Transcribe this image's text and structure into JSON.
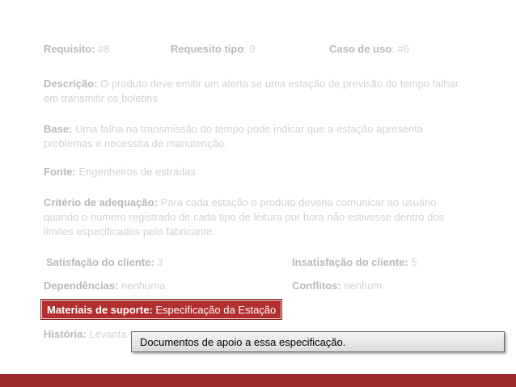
{
  "requisito": {
    "label": "Requisito:",
    "value": "#8"
  },
  "requisito_tipo": {
    "label": "Requesito tipo",
    "value": ": 9"
  },
  "caso_uso": {
    "label": "Caso de uso",
    "value": ": #6"
  },
  "descricao": {
    "label": "Descrição:",
    "value": "O produto deve emitir um alerta se uma estação de previsão do tempo falhar em transmitir  os boletins"
  },
  "base": {
    "label": "Base:",
    "value": "Uma falha na transmissão do tempo pode indicar que a estação apresenta problemas e necessita de manutenção."
  },
  "fonte": {
    "label": "Fonte:",
    "value": "Engenheiros de estradas"
  },
  "criterio": {
    "label": "Critério de adequação:",
    "value": "Para cada estação o produto deveria comunicar ao usuário quando o número registrado de cada tipo de leitura por hora não estivesse dentro dos limites especificados pelo fabricante."
  },
  "satisfacao": {
    "label": "Satisfação do cliente:",
    "value": "3"
  },
  "insatisfacao": {
    "label": "Insatisfação do cliente:",
    "value": "5"
  },
  "dependencias": {
    "label": "Dependências:",
    "value": "nenhuma"
  },
  "conflitos": {
    "label": "Conflitos:",
    "value": "nenhum"
  },
  "materiais": {
    "label": "Materiais de suporte:",
    "value": "Especificação da Estação"
  },
  "historia": {
    "label": "História:",
    "value": "Levanta"
  },
  "tooltip": {
    "text": "Documentos de apoio a essa especificação."
  },
  "colors": {
    "accent": "#b22f2f",
    "bar": "#9e2b2b",
    "faded_text": "#cfcfcf"
  }
}
